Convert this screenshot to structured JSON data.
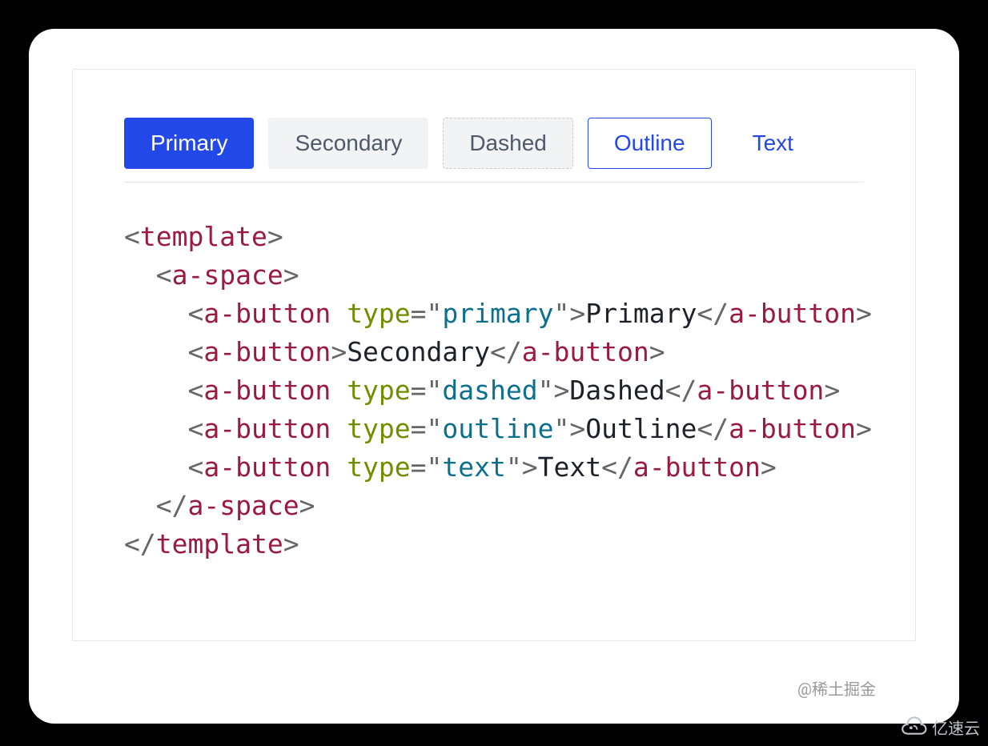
{
  "buttons": {
    "primary": "Primary",
    "secondary": "Secondary",
    "dashed": "Dashed",
    "outline": "Outline",
    "text": "Text"
  },
  "code": {
    "tag_template": "template",
    "tag_space": "a-space",
    "tag_button": "a-button",
    "attr_type": "type",
    "val_primary": "primary",
    "val_dashed": "dashed",
    "val_outline": "outline",
    "val_text": "text",
    "txt_primary": "Primary",
    "txt_secondary": "Secondary",
    "txt_dashed": "Dashed",
    "txt_outline": "Outline",
    "txt_text": "Text"
  },
  "punct": {
    "lt": "<",
    "lts": "</",
    "gt": ">",
    "eq": "=",
    "q": "\""
  },
  "watermark": "@稀土掘金",
  "brand": "亿速云",
  "colors": {
    "primary": "#2249E8",
    "secondary_bg": "#F2F3F5",
    "secondary_fg": "#4E5969",
    "border": "#E5E6EB",
    "tag": "#9A1B3F",
    "attr_name": "#6F8E00",
    "attr_val": "#0D6F8E"
  }
}
